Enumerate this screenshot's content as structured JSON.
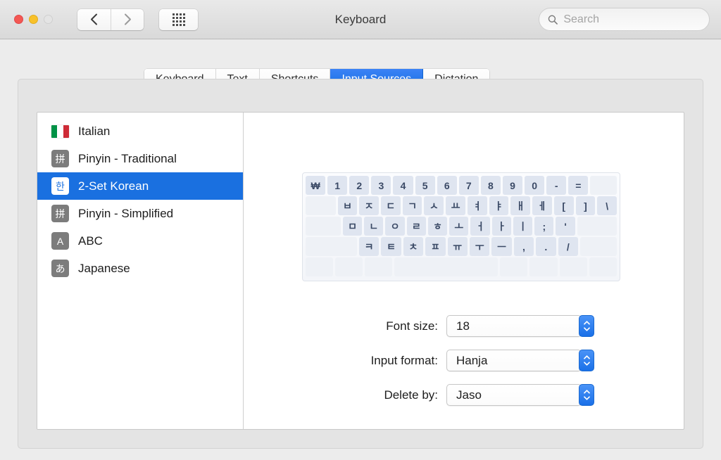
{
  "window": {
    "title": "Keyboard",
    "traffic_lights": [
      "close",
      "minimize",
      "zoom"
    ],
    "nav_back_icon": "chevron-left-icon",
    "nav_forward_icon": "chevron-right-icon",
    "grid_icon": "show-all-preferences-icon"
  },
  "search": {
    "placeholder": "Search",
    "value": "",
    "icon": "search-icon"
  },
  "tabs": [
    {
      "label": "Keyboard",
      "selected": false
    },
    {
      "label": "Text",
      "selected": false
    },
    {
      "label": "Shortcuts",
      "selected": false
    },
    {
      "label": "Input Sources",
      "selected": true
    },
    {
      "label": "Dictation",
      "selected": false
    }
  ],
  "input_sources": [
    {
      "label": "Italian",
      "icon": "italian-flag-icon",
      "badge": "",
      "selected": false
    },
    {
      "label": "Pinyin - Traditional",
      "icon": "pinyin-badge-icon",
      "badge": "拼",
      "selected": false
    },
    {
      "label": "2-Set Korean",
      "icon": "korean-badge-icon",
      "badge": "한",
      "selected": true
    },
    {
      "label": "Pinyin - Simplified",
      "icon": "pinyin-badge-icon",
      "badge": "拼",
      "selected": false
    },
    {
      "label": "ABC",
      "icon": "abc-badge-icon",
      "badge": "A",
      "selected": false
    },
    {
      "label": "Japanese",
      "icon": "japanese-badge-icon",
      "badge": "あ",
      "selected": false
    }
  ],
  "keyboard_preview": {
    "layout_name": "2-Set Korean",
    "rows": [
      [
        {
          "label": "₩",
          "blank": false,
          "width": ""
        },
        {
          "label": "1",
          "blank": false,
          "width": ""
        },
        {
          "label": "2",
          "blank": false,
          "width": ""
        },
        {
          "label": "3",
          "blank": false,
          "width": ""
        },
        {
          "label": "4",
          "blank": false,
          "width": ""
        },
        {
          "label": "5",
          "blank": false,
          "width": ""
        },
        {
          "label": "6",
          "blank": false,
          "width": ""
        },
        {
          "label": "7",
          "blank": false,
          "width": ""
        },
        {
          "label": "8",
          "blank": false,
          "width": ""
        },
        {
          "label": "9",
          "blank": false,
          "width": ""
        },
        {
          "label": "0",
          "blank": false,
          "width": ""
        },
        {
          "label": "-",
          "blank": false,
          "width": ""
        },
        {
          "label": "=",
          "blank": false,
          "width": ""
        },
        {
          "label": "",
          "blank": true,
          "width": "w-13"
        }
      ],
      [
        {
          "label": "",
          "blank": true,
          "width": "w-15"
        },
        {
          "label": "ㅂ",
          "blank": false,
          "width": ""
        },
        {
          "label": "ㅈ",
          "blank": false,
          "width": ""
        },
        {
          "label": "ㄷ",
          "blank": false,
          "width": ""
        },
        {
          "label": "ㄱ",
          "blank": false,
          "width": ""
        },
        {
          "label": "ㅅ",
          "blank": false,
          "width": ""
        },
        {
          "label": "ㅛ",
          "blank": false,
          "width": ""
        },
        {
          "label": "ㅕ",
          "blank": false,
          "width": ""
        },
        {
          "label": "ㅑ",
          "blank": false,
          "width": ""
        },
        {
          "label": "ㅐ",
          "blank": false,
          "width": ""
        },
        {
          "label": "ㅔ",
          "blank": false,
          "width": ""
        },
        {
          "label": "[",
          "blank": false,
          "width": ""
        },
        {
          "label": "]",
          "blank": false,
          "width": ""
        },
        {
          "label": "\\",
          "blank": false,
          "width": ""
        }
      ],
      [
        {
          "label": "",
          "blank": true,
          "width": "w-18"
        },
        {
          "label": "ㅁ",
          "blank": false,
          "width": ""
        },
        {
          "label": "ㄴ",
          "blank": false,
          "width": ""
        },
        {
          "label": "ㅇ",
          "blank": false,
          "width": ""
        },
        {
          "label": "ㄹ",
          "blank": false,
          "width": ""
        },
        {
          "label": "ㅎ",
          "blank": false,
          "width": ""
        },
        {
          "label": "ㅗ",
          "blank": false,
          "width": ""
        },
        {
          "label": "ㅓ",
          "blank": false,
          "width": ""
        },
        {
          "label": "ㅏ",
          "blank": false,
          "width": ""
        },
        {
          "label": "ㅣ",
          "blank": false,
          "width": ""
        },
        {
          "label": ";",
          "blank": false,
          "width": ""
        },
        {
          "label": "'",
          "blank": false,
          "width": ""
        },
        {
          "label": "",
          "blank": true,
          "width": "w-20"
        }
      ],
      [
        {
          "label": "",
          "blank": true,
          "width": "w-25"
        },
        {
          "label": "ㅋ",
          "blank": false,
          "width": ""
        },
        {
          "label": "ㅌ",
          "blank": false,
          "width": ""
        },
        {
          "label": "ㅊ",
          "blank": false,
          "width": ""
        },
        {
          "label": "ㅍ",
          "blank": false,
          "width": ""
        },
        {
          "label": "ㅠ",
          "blank": false,
          "width": ""
        },
        {
          "label": "ㅜ",
          "blank": false,
          "width": ""
        },
        {
          "label": "ㅡ",
          "blank": false,
          "width": ""
        },
        {
          "label": ",",
          "blank": false,
          "width": ""
        },
        {
          "label": ".",
          "blank": false,
          "width": ""
        },
        {
          "label": "/",
          "blank": false,
          "width": ""
        },
        {
          "label": "",
          "blank": true,
          "width": "w-18"
        }
      ],
      [
        {
          "label": "",
          "blank": true,
          "width": "w-13"
        },
        {
          "label": "",
          "blank": true,
          "width": "w-13"
        },
        {
          "label": "",
          "blank": true,
          "width": "w-13"
        },
        {
          "label": "",
          "blank": true,
          "width": "w-50"
        },
        {
          "label": "",
          "blank": true,
          "width": "w-13"
        },
        {
          "label": "",
          "blank": true,
          "width": "w-13"
        },
        {
          "label": "",
          "blank": true,
          "width": "w-13"
        },
        {
          "label": "",
          "blank": true,
          "width": "w-13"
        }
      ]
    ]
  },
  "settings": [
    {
      "label": "Font size:",
      "value": "18",
      "name": "font-size"
    },
    {
      "label": "Input format:",
      "value": "Hanja",
      "name": "input-format"
    },
    {
      "label": "Delete by:",
      "value": "Jaso",
      "name": "delete-by"
    }
  ],
  "colors": {
    "accent_blue": "#1a70e0",
    "window_bg": "#ececec",
    "panel_bg": "#ffffff",
    "key_bg": "#dfe5f0",
    "key_text": "#3b4a66"
  }
}
